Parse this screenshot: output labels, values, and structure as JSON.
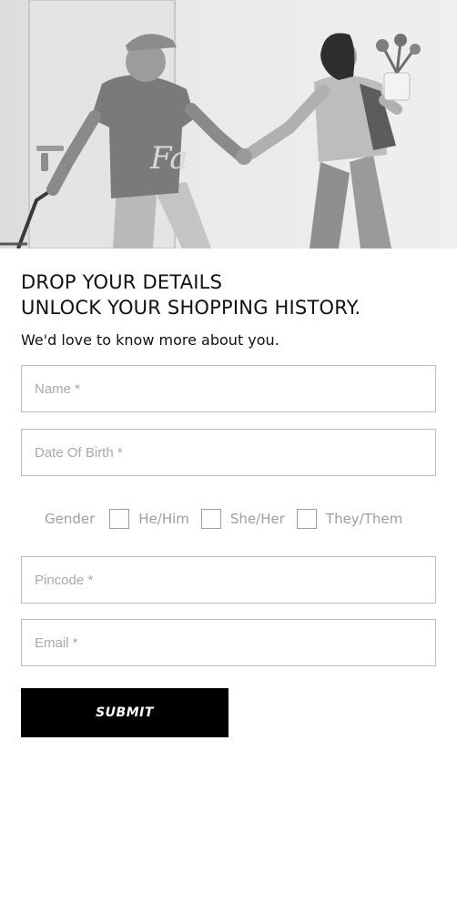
{
  "hero": {
    "shirt_print": "Fa"
  },
  "form": {
    "heading_line1": "DROP YOUR DETAILS",
    "heading_line2": "UNLOCK YOUR SHOPPING HISTORY.",
    "subtitle": "We'd love to know more about you.",
    "name_placeholder": "Name *",
    "dob_placeholder": "Date Of Birth *",
    "gender": {
      "label": "Gender",
      "options": [
        "He/Him",
        "She/Her",
        "They/Them"
      ]
    },
    "pincode_placeholder": "Pincode *",
    "email_placeholder": "Email *",
    "submit_label": "SUBMIT"
  },
  "colors": {
    "button_bg": "#000000",
    "button_text": "#ffffff",
    "border": "#bdbdbd",
    "placeholder": "#a9a9a9"
  }
}
